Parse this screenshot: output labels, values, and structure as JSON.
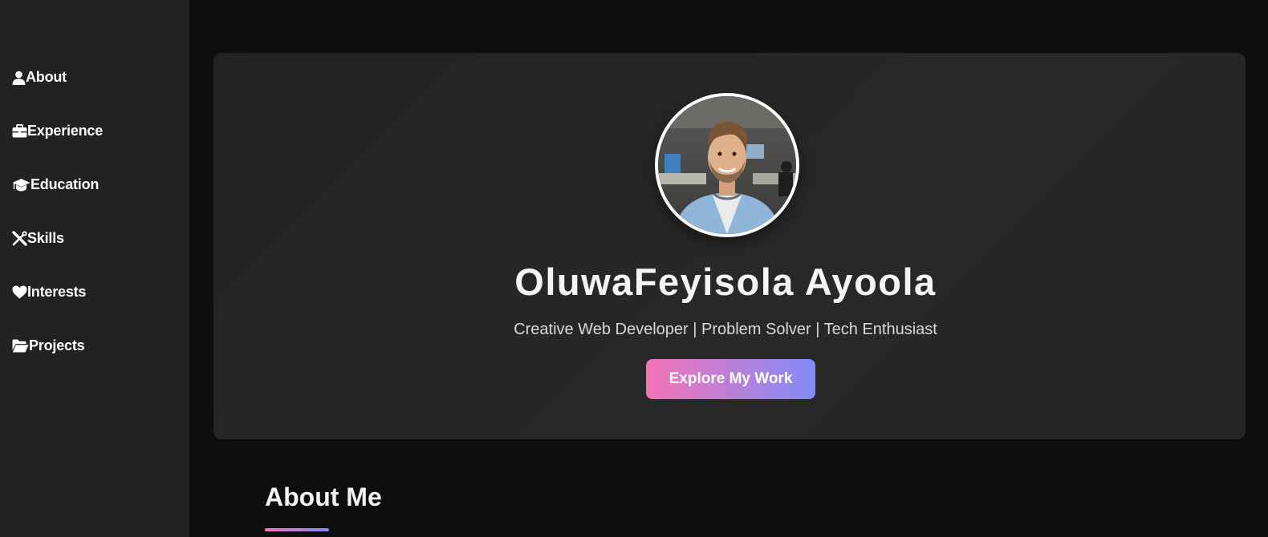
{
  "sidebar": {
    "items": [
      {
        "label": "About",
        "icon": "user-icon"
      },
      {
        "label": "Experience",
        "icon": "briefcase-icon"
      },
      {
        "label": "Education",
        "icon": "graduation-cap-icon"
      },
      {
        "label": "Skills",
        "icon": "tools-icon"
      },
      {
        "label": "Interests",
        "icon": "heart-icon"
      },
      {
        "label": "Projects",
        "icon": "folder-open-icon"
      }
    ]
  },
  "hero": {
    "name": "OluwaFeyisola Ayoola",
    "tagline": "Creative Web Developer | Problem Solver | Tech Enthusiast",
    "cta_label": "Explore My Work",
    "avatar": "profile-photo"
  },
  "about": {
    "title": "About Me"
  },
  "colors": {
    "page_bg": "#0e0e0e",
    "sidebar_bg": "#222222",
    "card_bg": "#262626",
    "accent_start": "#f472b6",
    "accent_end": "#818cf8"
  }
}
